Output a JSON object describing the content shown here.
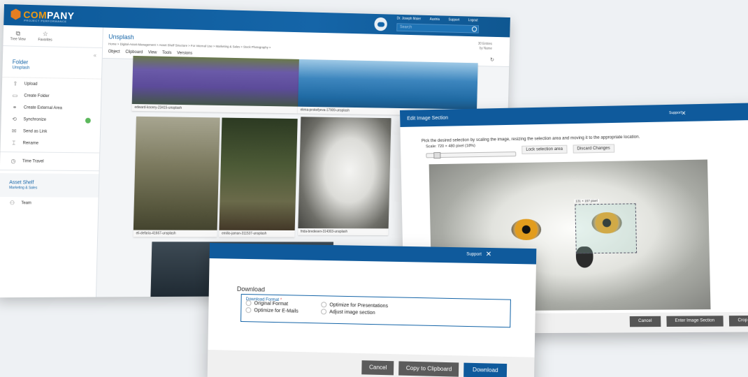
{
  "app": {
    "logo": {
      "prefix": "COM",
      "rest": "PANY",
      "tagline": "PROJECT PERFORMANCE"
    },
    "toplinks": [
      "Dr. Joseph Maier",
      "Austria",
      "Support",
      "Logout"
    ],
    "search_placeholder": "Search",
    "tabs": [
      {
        "icon": "tree-view-icon",
        "label": "Tree View"
      },
      {
        "icon": "star-icon",
        "label": "Favorites"
      }
    ],
    "folder": {
      "heading": "Folder",
      "name": "Unsplash"
    },
    "actions": [
      {
        "icon": "upload-icon",
        "label": "Upload"
      },
      {
        "icon": "create-folder-icon",
        "label": "Create Folder"
      },
      {
        "icon": "external-area-icon",
        "label": "Create External Area"
      },
      {
        "icon": "synchronize-icon",
        "label": "Synchronize"
      },
      {
        "icon": "send-link-icon",
        "label": "Send as Link"
      },
      {
        "icon": "rename-icon",
        "label": "Rename"
      },
      {
        "icon": "time-travel-icon",
        "label": "Time Travel"
      }
    ],
    "shelf": {
      "heading": "Asset Shelf",
      "sub": "Marketing & Sales",
      "item": "Team"
    },
    "main": {
      "title": "Unsplash",
      "breadcrumb": "Home > Digital-Asset-Management > Asset Shelf Structure > For Internal Use > Marketing & Sales > Stock Photography >",
      "entries": "30 Entries",
      "sort": "by Name",
      "toolbar": [
        "Object",
        "Clipboard",
        "View",
        "Tools",
        "Versions"
      ]
    },
    "tiles": [
      "edward-koorey-23415-unsplash",
      "elena-prokofyeva-17909-unsplash",
      "eli-defaria-41667-unsplash",
      "emilio-jaman-311537-unsplash",
      "frida-bredesen-314303-unsplash"
    ]
  },
  "edit": {
    "title": "Edit Image Section",
    "support": "Support",
    "description": "Pick the desired selection by scaling the image, resizing the selection area and moving it to the appropriate location.",
    "scale": "Scale: 720 × 480 pixel (18%)",
    "lock": "Lock selection area",
    "discard": "Discard Changes",
    "selection_label": "131 × 157 pixel",
    "buttons": {
      "cancel": "Cancel",
      "enter": "Enter Image Section",
      "crop": "Crop"
    }
  },
  "download": {
    "support": "Support",
    "title": "Download",
    "legend": "Download Format",
    "required": "*",
    "options": [
      "Original Format",
      "Optimize for Presentations",
      "Optimize for E-Mails",
      "Adjust image section"
    ],
    "buttons": {
      "cancel": "Cancel",
      "clipboard": "Copy to Clipboard",
      "download": "Download"
    }
  }
}
